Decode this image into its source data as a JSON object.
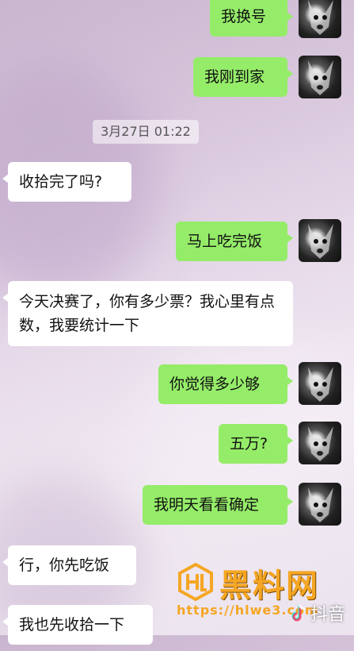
{
  "timestamp": "3月27日 01:22",
  "messages": [
    {
      "side": "out",
      "text": "我换号"
    },
    {
      "side": "out",
      "text": "我刚到家"
    },
    {
      "side": "in",
      "text": "收拾完了吗?"
    },
    {
      "side": "out",
      "text": "马上吃完饭"
    },
    {
      "side": "in",
      "text": "今天决赛了，你有多少票？我心里有点数，我要统计一下"
    },
    {
      "side": "out",
      "text": "你觉得多少够"
    },
    {
      "side": "out",
      "text": "五万?"
    },
    {
      "side": "out",
      "text": "我明天看看确定"
    },
    {
      "side": "in",
      "text": "行，你先吃饭"
    },
    {
      "side": "in",
      "text": "我也先收拾一下"
    }
  ],
  "watermark": {
    "title": "黑料网",
    "url": "https://hlwe3.com",
    "platform": "抖音"
  },
  "colors": {
    "outgoing_bubble": "#95ec69",
    "incoming_bubble": "#ffffff",
    "watermark": "#f5a623"
  },
  "icons": {
    "avatar": "dog-avatar-icon",
    "logo": "watermark-logo-icon",
    "platform": "douyin-icon"
  }
}
